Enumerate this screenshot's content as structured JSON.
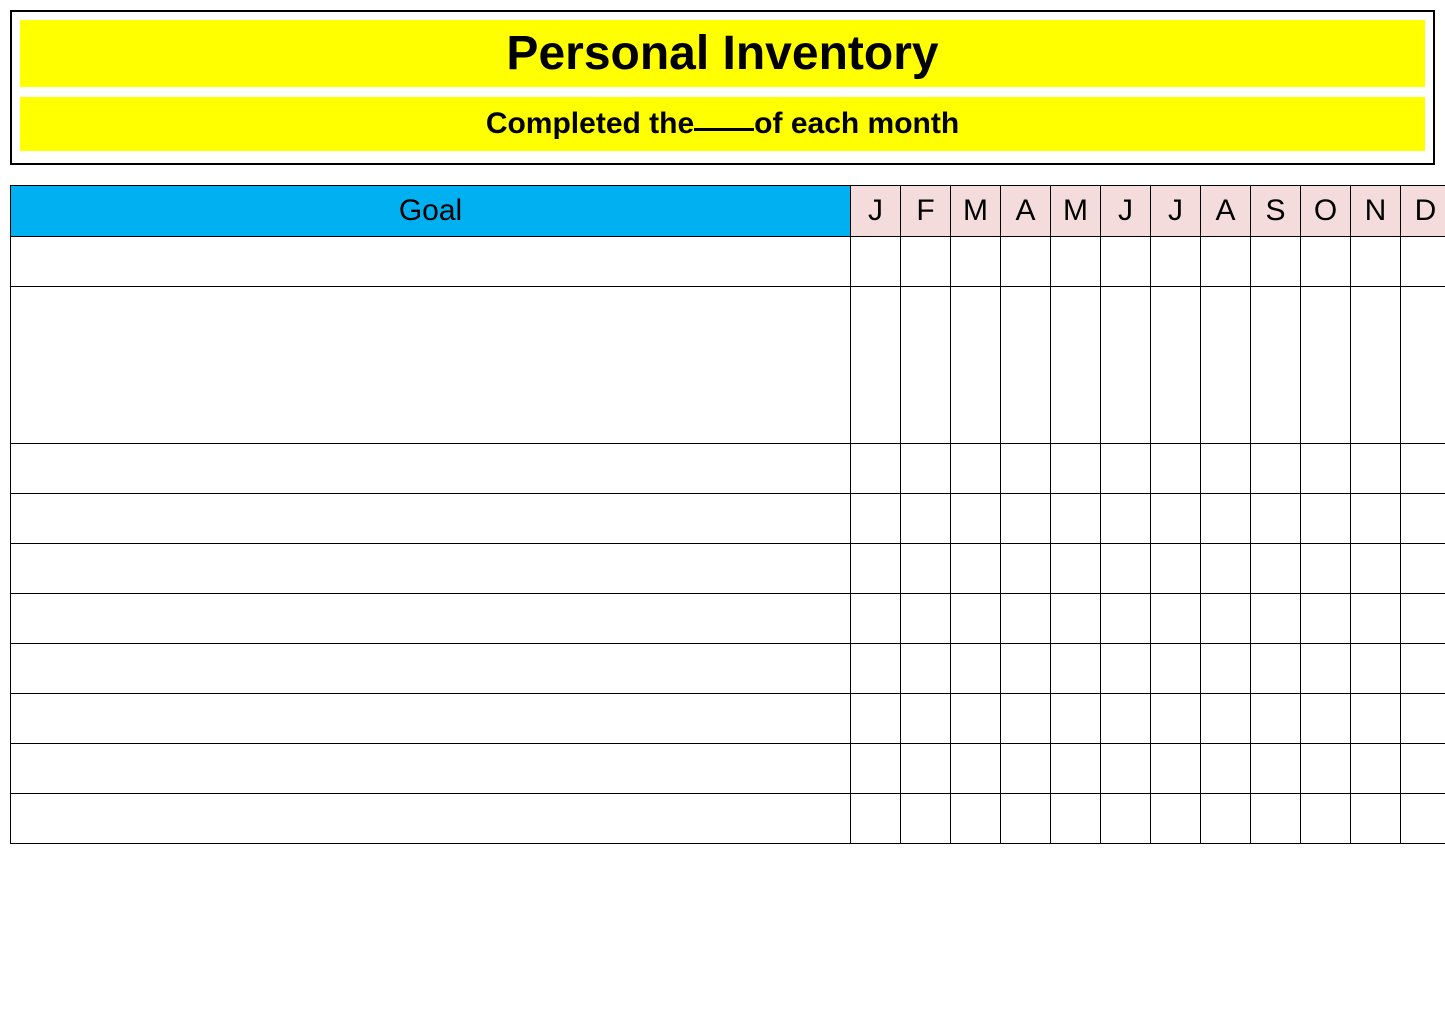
{
  "header": {
    "title": "Personal Inventory",
    "subtitle_prefix": "Completed the",
    "subtitle_suffix": "of each month"
  },
  "table": {
    "goal_header": "Goal",
    "months": [
      "J",
      "F",
      "M",
      "A",
      "M",
      "J",
      "J",
      "A",
      "S",
      "O",
      "N",
      "D"
    ],
    "row_heights": [
      "short",
      "tall",
      "short",
      "short",
      "short",
      "short",
      "short",
      "short",
      "short",
      "short"
    ]
  }
}
